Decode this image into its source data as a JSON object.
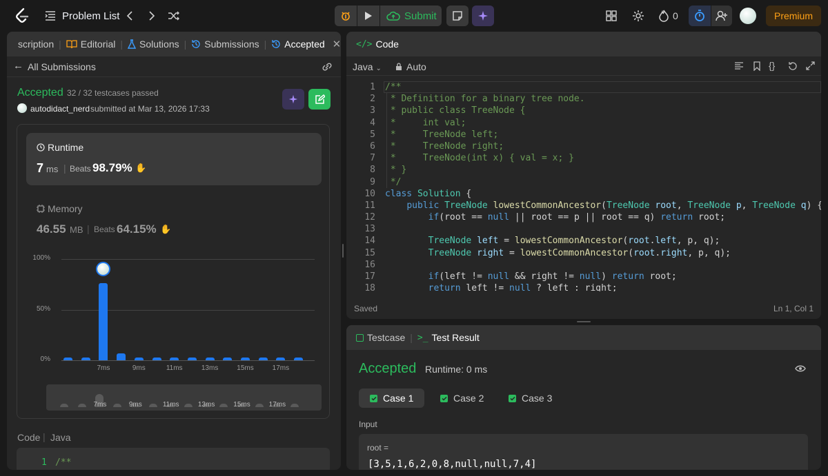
{
  "topbar": {
    "problem_list": "Problem List",
    "submit": "Submit",
    "streak_count": "0",
    "premium": "Premium"
  },
  "left_tabs": [
    {
      "label": "scription"
    },
    {
      "label": "Editorial"
    },
    {
      "label": "Solutions"
    },
    {
      "label": "Submissions"
    },
    {
      "label": "Accepted"
    }
  ],
  "submission": {
    "back_label": "All Submissions",
    "status": "Accepted",
    "testcases": "32 / 32 testcases passed",
    "user": "autodidact_nerd",
    "submitted_at": "submitted at Mar 13, 2026 17:33",
    "runtime_title": "Runtime",
    "runtime_value": "7",
    "runtime_unit": "ms",
    "beats_label": "Beats",
    "runtime_beats": "98.79%",
    "memory_title": "Memory",
    "memory_value": "46.55",
    "memory_unit": "MB",
    "memory_beats": "64.15%",
    "code_label": "Code",
    "code_lang": "Java",
    "code_first_line_no": "1",
    "code_first_line": "/**"
  },
  "chart_data": {
    "type": "bar",
    "y_ticks": [
      "100%",
      "50%",
      "0%"
    ],
    "ylim": [
      0,
      100
    ],
    "x_labels": [
      "7ms",
      "9ms",
      "11ms",
      "13ms",
      "15ms",
      "17ms"
    ],
    "x_label_indices": [
      2,
      4,
      6,
      8,
      10,
      12
    ],
    "values": [
      3,
      3,
      76,
      7,
      3,
      3,
      3,
      3,
      3,
      3,
      3,
      3,
      3,
      3
    ],
    "highlight_index": 2,
    "mini_x_labels": [
      "7ms",
      "9ms",
      "11ms",
      "13ms",
      "15ms",
      "17ms"
    ],
    "bar_color": "#1e78f0"
  },
  "code_panel": {
    "title": "Code",
    "language": "Java",
    "mode": "Auto",
    "status": "Saved",
    "cursor": "Ln 1, Col 1",
    "line_numbers": [
      "1",
      "2",
      "3",
      "4",
      "5",
      "6",
      "7",
      "8",
      "9",
      "10",
      "11",
      "12",
      "13",
      "14",
      "15",
      "16",
      "17",
      "18"
    ]
  },
  "test_panel": {
    "tab_testcase": "Testcase",
    "tab_result": "Test Result",
    "status": "Accepted",
    "runtime": "Runtime: 0 ms",
    "cases": [
      "Case 1",
      "Case 2",
      "Case 3"
    ],
    "input_label": "Input",
    "var_label": "root =",
    "var_value": "[3,5,1,6,2,0,8,null,null,7,4]"
  },
  "colors": {
    "accent_green": "#2cbb5d",
    "premium": "#ffa116",
    "blue": "#1e78f0"
  }
}
